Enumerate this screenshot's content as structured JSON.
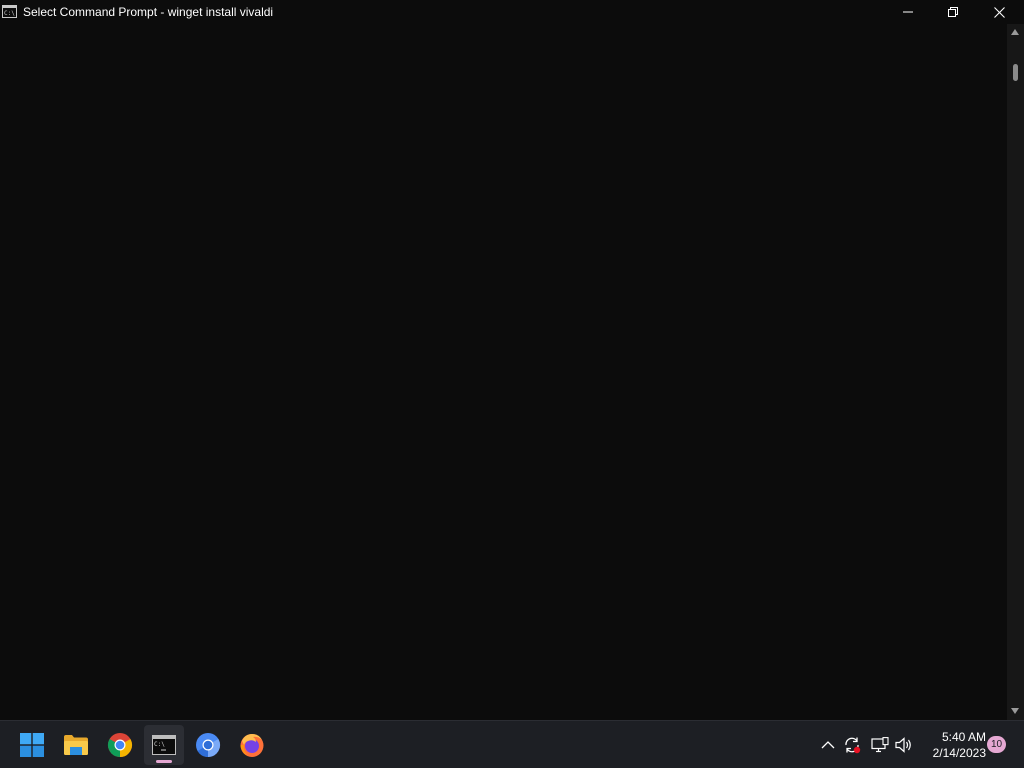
{
  "window": {
    "title": "Select Command Prompt - winget  install vivaldi",
    "app_icon": "cmd-icon",
    "controls": {
      "minimize": "minimize-icon",
      "maximize": "restore-icon",
      "close": "close-icon"
    }
  },
  "console": {
    "background": "#0c0c0c",
    "lines": []
  },
  "scrollbar": {
    "position": 0.0
  },
  "taskbar": {
    "apps": [
      {
        "name": "Start",
        "icon": "windows-start-icon",
        "active": false
      },
      {
        "name": "File Explorer",
        "icon": "folder-icon",
        "active": false
      },
      {
        "name": "Google Chrome",
        "icon": "chrome-icon",
        "active": false
      },
      {
        "name": "Command Prompt",
        "icon": "terminal-icon",
        "active": true
      },
      {
        "name": "Chromium",
        "icon": "chromium-icon",
        "active": false
      },
      {
        "name": "Firefox",
        "icon": "firefox-icon",
        "active": false
      }
    ],
    "tray": {
      "icons": [
        "chevron-up-icon",
        "sync-icon",
        "network-icon",
        "volume-icon"
      ],
      "time": "5:40 AM",
      "date": "2/14/2023",
      "notification_count": "10"
    },
    "accent_color": "#e5a8d3"
  }
}
